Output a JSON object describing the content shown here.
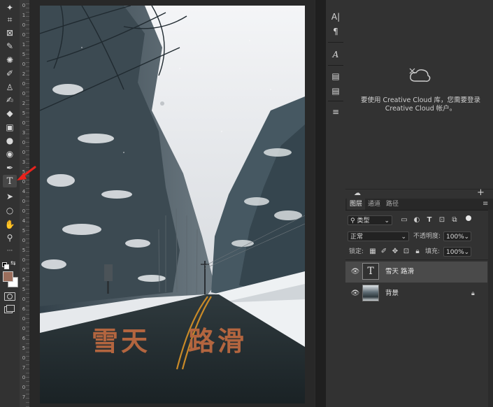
{
  "toolbar": {
    "tools": [
      {
        "name": "magic-wand-tool",
        "glyph": "✦"
      },
      {
        "name": "crop-tool",
        "glyph": "⌗"
      },
      {
        "name": "frame-tool",
        "glyph": "⊠"
      },
      {
        "name": "eyedropper-tool",
        "glyph": "✎"
      },
      {
        "name": "spot-healing-tool",
        "glyph": "✺"
      },
      {
        "name": "brush-tool",
        "glyph": "✐"
      },
      {
        "name": "clone-stamp-tool",
        "glyph": "♙"
      },
      {
        "name": "history-brush-tool",
        "glyph": "✍"
      },
      {
        "name": "eraser-tool",
        "glyph": "◆"
      },
      {
        "name": "gradient-tool",
        "glyph": "▣"
      },
      {
        "name": "blur-tool",
        "glyph": "●"
      },
      {
        "name": "dodge-tool",
        "glyph": "◉"
      },
      {
        "name": "pen-tool",
        "glyph": "✒"
      },
      {
        "name": "type-tool",
        "glyph": "T"
      },
      {
        "name": "path-selection-tool",
        "glyph": "➤"
      },
      {
        "name": "ellipse-tool",
        "glyph": "○"
      },
      {
        "name": "hand-tool",
        "glyph": "✋"
      },
      {
        "name": "zoom-tool",
        "glyph": "⚲"
      },
      {
        "name": "edit-toolbar",
        "glyph": "···"
      }
    ]
  },
  "ruler": {
    "labels": [
      "0",
      "1",
      "0",
      "0",
      "1",
      "5",
      "0",
      "2",
      "0",
      "0",
      "2",
      "5",
      "0",
      "3",
      "0",
      "0",
      "3",
      "5",
      "0",
      "4",
      "0",
      "0",
      "4",
      "5",
      "0",
      "5",
      "0",
      "0",
      "5",
      "5",
      "0",
      "6",
      "0",
      "0",
      "6",
      "5",
      "0",
      "7",
      "0",
      "0",
      "7"
    ]
  },
  "canvas": {
    "overlay_text_left": "雪天",
    "overlay_text_right": "路滑",
    "overlay_color": "#b3653f"
  },
  "strip_icons": [
    "A|",
    "¶",
    "A",
    "▤",
    "▤",
    "≡"
  ],
  "libraries": {
    "message": "要使用 Creative Cloud 库，您需要登录 Creative Cloud 帐户。"
  },
  "layers_panel": {
    "tabs": [
      "图层",
      "通道",
      "路径"
    ],
    "active_tab": "图层",
    "filter_label": "类型",
    "blend_mode": "正常",
    "opacity_label": "不透明度:",
    "opacity_value": "100%",
    "lock_label": "锁定:",
    "fill_label": "填充:",
    "fill_value": "100%",
    "layers": [
      {
        "name": "雪天  路滑",
        "kind": "text",
        "selected": true
      },
      {
        "name": "背景",
        "kind": "image",
        "selected": false,
        "locked": true
      }
    ]
  },
  "colors": {
    "foreground": "#9b6e5c",
    "background": "#ffffff",
    "annotation_arrow": "#e8231d"
  }
}
